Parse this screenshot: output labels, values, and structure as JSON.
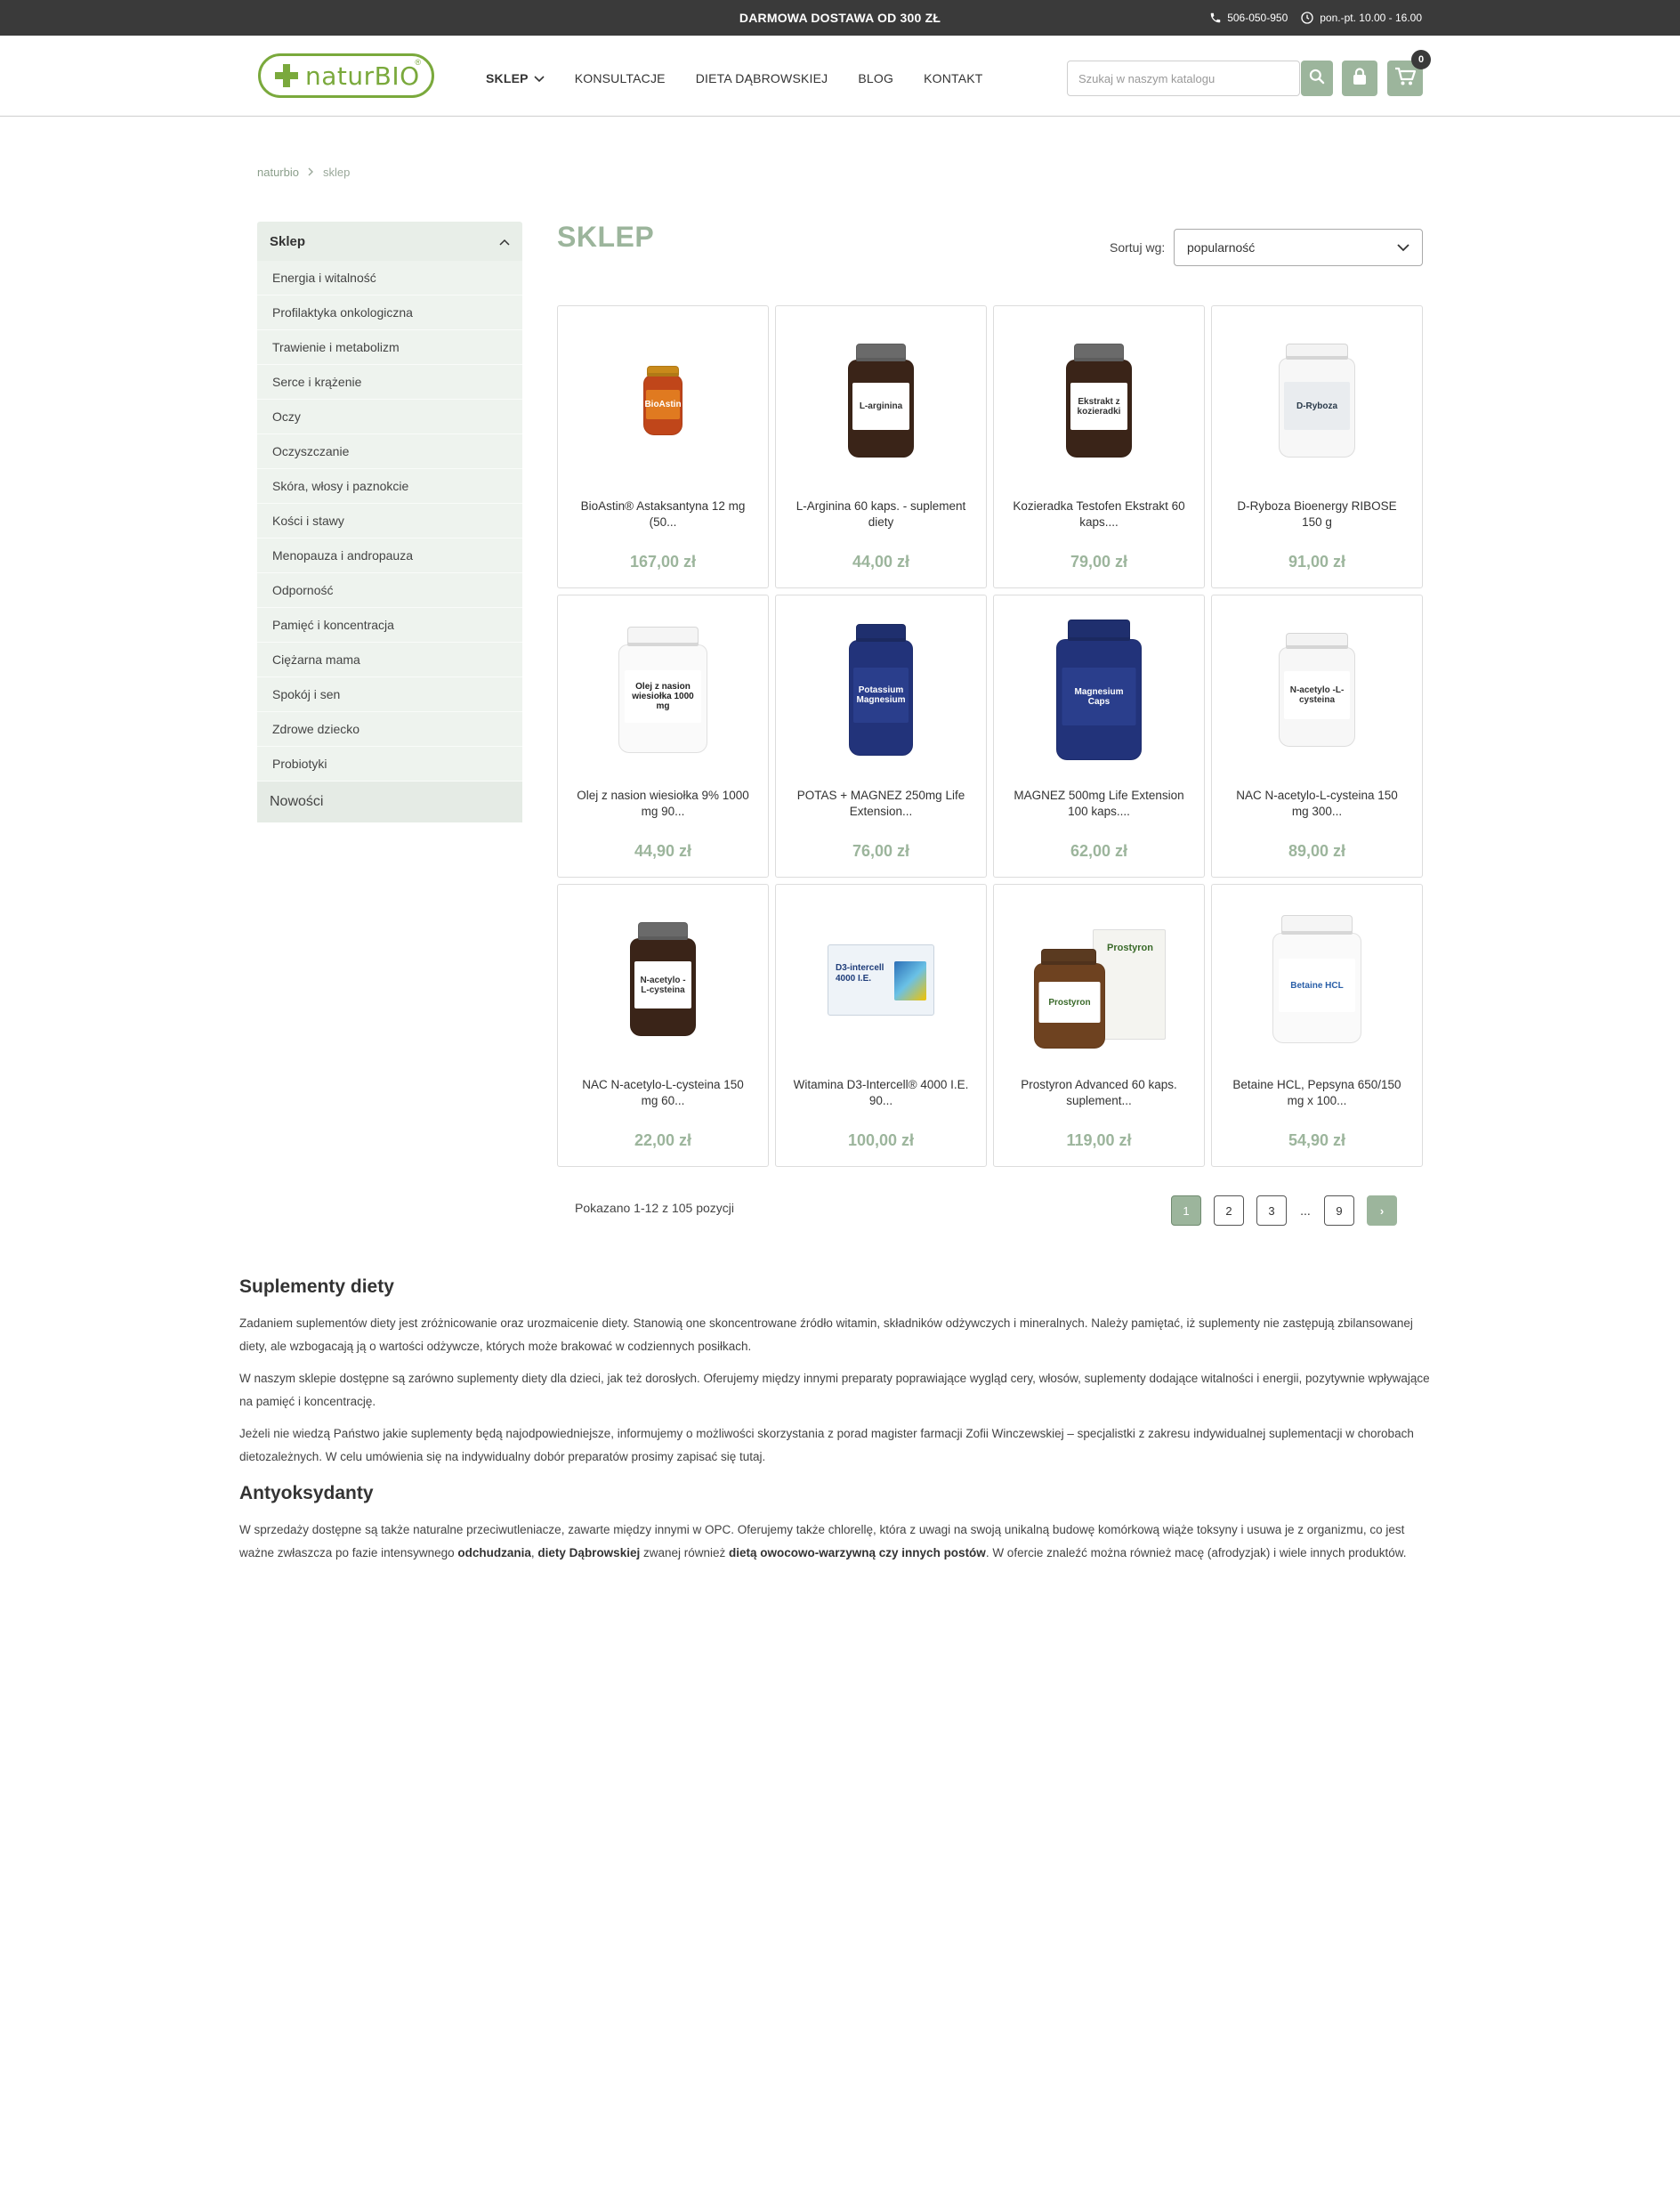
{
  "topbar": {
    "promo": "DARMOWA DOSTAWA OD 300 ZŁ",
    "phone": "506-050-950",
    "hours": "pon.-pt. 10.00 - 16.00"
  },
  "header": {
    "logo_text": "naturBIO",
    "logo_reg": "®",
    "nav": [
      {
        "label": "SKLEP",
        "has_dropdown": true,
        "active": true
      },
      {
        "label": "KONSULTACJE"
      },
      {
        "label": "DIETA DĄBROWSKIEJ"
      },
      {
        "label": "BLOG"
      },
      {
        "label": "KONTAKT"
      }
    ],
    "search_placeholder": "Szukaj w naszym katalogu",
    "cart_count": "0"
  },
  "breadcrumb": {
    "home": "naturbio",
    "current": "sklep"
  },
  "sidebar": {
    "title": "Sklep",
    "items": [
      "Energia i witalność",
      "Profilaktyka onkologiczna",
      "Trawienie i metabolizm",
      "Serce i krążenie",
      "Oczy",
      "Oczyszczanie",
      "Skóra, włosy i paznokcie",
      "Kości i stawy",
      "Menopauza i andropauza",
      "Odporność",
      "Pamięć i koncentracja",
      "Ciężarna mama",
      "Spokój i sen",
      "Zdrowe dziecko",
      "Probiotyki"
    ],
    "footer": "Nowości"
  },
  "main": {
    "title": "SKLEP",
    "sort_label": "Sortuj wg:",
    "sort_value": "popularność",
    "products": [
      {
        "name": "BioAstin® Astaksantyna 12 mg (50...",
        "price": "167,00 zł",
        "jar": {
          "cap": "#c98a1a",
          "body": "#c0461a",
          "label": "BioAstin",
          "labelbg": "#e07a20",
          "labelcolor": "#ffffff",
          "w": 44,
          "h": 68,
          "capw": 36,
          "caph": 12
        }
      },
      {
        "name": "L-Arginina 60 kaps. - suplement diety",
        "price": "44,00 zł",
        "jar": {
          "cap": "#6a6a6a",
          "body": "#3a2418",
          "label": "L-arginina",
          "labelbg": "#ffffff",
          "labelcolor": "#333333",
          "w": 74,
          "h": 110,
          "capw": 56,
          "caph": 20
        }
      },
      {
        "name": "Kozieradka Testofen Ekstrakt 60 kaps....",
        "price": "79,00 zł",
        "jar": {
          "cap": "#6a6a6a",
          "body": "#3a2418",
          "label": "Ekstrakt z kozieradki",
          "labelbg": "#ffffff",
          "labelcolor": "#333333",
          "w": 74,
          "h": 110,
          "capw": 56,
          "caph": 20
        }
      },
      {
        "name": "D-Ryboza Bioenergy RIBOSE 150 g",
        "price": "91,00 zł",
        "jar": {
          "cap": "#f3f3f3",
          "body": "#f7f7f7",
          "label": "D-Ryboza",
          "labelbg": "#e9ecef",
          "labelcolor": "#2a3a4a",
          "w": 86,
          "h": 112,
          "capw": 70,
          "caph": 18
        }
      },
      {
        "name": "Olej z nasion wiesiołka 9% 1000 mg 90...",
        "price": "44,90 zł",
        "jar": {
          "cap": "#f5f5f5",
          "body": "#fafafa",
          "label": "Olej z nasion wiesiołka 1000 mg",
          "labelbg": "#ffffff",
          "labelcolor": "#222222",
          "w": 100,
          "h": 122,
          "capw": 80,
          "caph": 22
        }
      },
      {
        "name": "POTAS + MAGNEZ 250mg Life Extension...",
        "price": "76,00 zł",
        "jar": {
          "cap": "#1f2f6e",
          "body": "#22337a",
          "label": "Potassium Magnesium",
          "labelbg": "#2a3e8c",
          "labelcolor": "#ffffff",
          "w": 72,
          "h": 130,
          "capw": 56,
          "caph": 20
        }
      },
      {
        "name": "MAGNEZ 500mg Life Extension 100 kaps....",
        "price": "62,00 zł",
        "jar": {
          "cap": "#1f2f6e",
          "body": "#22337a",
          "label": "Magnesium Caps",
          "labelbg": "#2a3e8c",
          "labelcolor": "#ffffff",
          "w": 96,
          "h": 136,
          "capw": 70,
          "caph": 24
        }
      },
      {
        "name": "NAC N-acetylo-L-cysteina 150 mg 300...",
        "price": "89,00 zł",
        "jar": {
          "cap": "#f3f3f3",
          "body": "#f7f7f7",
          "label": "N-acetylo -L-cysteina",
          "labelbg": "#ffffff",
          "labelcolor": "#333333",
          "w": 86,
          "h": 112,
          "capw": 70,
          "caph": 18
        }
      },
      {
        "name": "NAC N-acetylo-L-cysteina 150 mg 60...",
        "price": "22,00 zł",
        "jar": {
          "cap": "#6a6a6a",
          "body": "#3a2418",
          "label": "N-acetylo -L-cysteina",
          "labelbg": "#ffffff",
          "labelcolor": "#333333",
          "w": 74,
          "h": 110,
          "capw": 56,
          "caph": 20
        }
      },
      {
        "name": "Witamina D3-Intercell® 4000 I.E. 90...",
        "price": "100,00 zł",
        "jar": {
          "cap": "#ffffff",
          "body": "#ffffff",
          "label": "D3-intercell 4000 I.E.",
          "labelbg": "#eef3f8",
          "labelcolor": "#1f3d7a",
          "w": 120,
          "h": 80,
          "capw": 0,
          "caph": 0,
          "box": true
        }
      },
      {
        "name": "Prostyron Advanced 60 kaps. suplement...",
        "price": "119,00 zł",
        "jar": {
          "cap": "#5a3a20",
          "body": "#6e4220",
          "label": "Prostyron",
          "labelbg": "#ffffff",
          "labelcolor": "#3a6a2a",
          "w": 80,
          "h": 96,
          "capw": 62,
          "caph": 18,
          "withbox": true
        }
      },
      {
        "name": "Betaine HCL, Pepsyna 650/150 mg x 100...",
        "price": "54,90 zł",
        "jar": {
          "cap": "#f5f5f5",
          "body": "#fafafa",
          "label": "Betaine HCL",
          "labelbg": "#ffffff",
          "labelcolor": "#2a5fa8",
          "w": 100,
          "h": 124,
          "capw": 80,
          "caph": 22
        }
      }
    ]
  },
  "pagination": {
    "showing": "Pokazano 1-12 z 105 pozycji",
    "pages": [
      "1",
      "2",
      "3"
    ],
    "dots": "...",
    "last": "9",
    "next": "›"
  },
  "description": {
    "h1": "Suplementy diety",
    "p1": "Zadaniem suplementów diety jest zróżnicowanie oraz urozmaicenie diety. Stanowią one skoncentrowane źródło witamin, składników odżywczych i mineralnych. Należy pamiętać, iż suplementy nie zastępują zbilansowanej diety, ale wzbogacają ją o wartości odżywcze, których może brakować w codziennych posiłkach.",
    "p2": "W naszym sklepie dostępne są zarówno suplementy diety dla dzieci, jak też dorosłych. Oferujemy między innymi preparaty poprawiające wygląd cery, włosów, suplementy dodające witalności i energii, pozytywnie wpływające na pamięć i koncentrację.",
    "p3": "Jeżeli nie wiedzą Państwo jakie suplementy będą najodpowiedniejsze, informujemy o możliwości skorzystania z porad magister farmacji Zofii Winczewskiej – specjalistki z zakresu indywidualnej suplementacji w chorobach dietozależnych. W celu umówienia się na indywidualny dobór preparatów prosimy zapisać się tutaj.",
    "h2": "Antyoksydanty",
    "p4_a": "W sprzedaży dostępne są także naturalne przeciwutleniacze, zawarte między innymi w OPC. Oferujemy także chlorellę, która z uwagi na swoją unikalną budowę komórkową wiąże toksyny i usuwa je z organizmu, co jest ważne zwłaszcza po fazie intensywnego ",
    "p4_b1": "odchudzania",
    "p4_sep1": ", ",
    "p4_b2": "diety Dąbrowskiej",
    "p4_c": " zwanej również ",
    "p4_b3": "dietą owocowo-warzywną czy innych postów",
    "p4_d": ". W ofercie znaleźć można również macę (afrodyzjak) i wiele innych produktów."
  }
}
